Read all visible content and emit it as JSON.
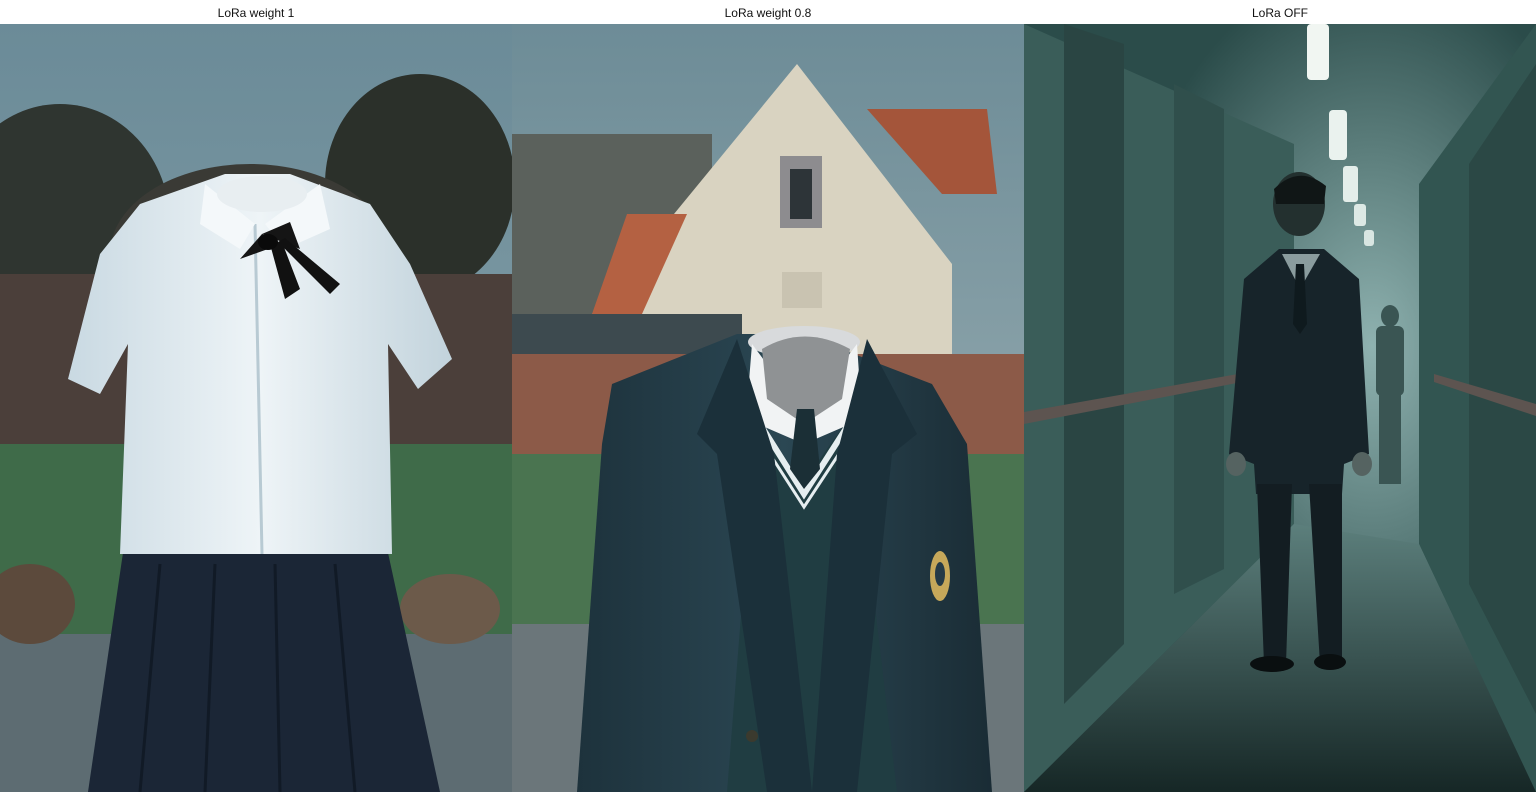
{
  "panels": [
    {
      "label": "LoRa weight 1"
    },
    {
      "label": "LoRa weight 0.8"
    },
    {
      "label": "LoRa OFF"
    }
  ],
  "colors": {
    "sky": "#5f7f8c",
    "grass": "#3f6b49",
    "skirt": "#1b2636",
    "blazer": "#233b47",
    "shirt": "#dfe9ef",
    "hallway": "#2f5551"
  }
}
